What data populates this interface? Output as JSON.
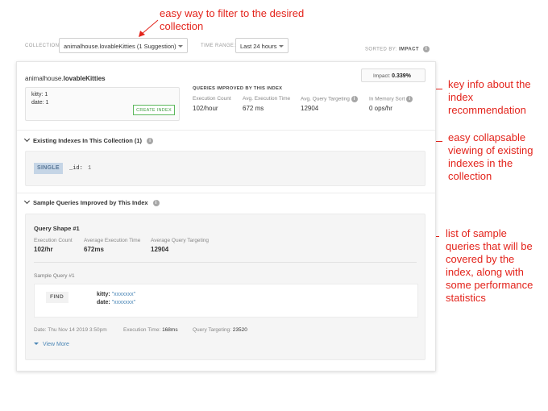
{
  "annotations": {
    "filter": [
      "easy way to filter to the desired",
      "collection"
    ],
    "key_info": [
      "key info about the",
      "index",
      "recommendation"
    ],
    "collapsable": [
      "easy collapsable",
      "viewing of existing",
      "indexes in the",
      "collection"
    ],
    "sample_queries": [
      "list of sample",
      "queries that will be",
      "covered by the",
      "index, along with",
      "some performance",
      "statistics"
    ]
  },
  "filter_bar": {
    "collection_label": "COLLECTION:",
    "collection_value": "animalhouse.lovableKitties (1 Suggestion)",
    "time_range_label": "TIME RANGE:",
    "time_range_value": "Last 24 hours",
    "sorted_by_label": "SORTED BY:",
    "sorted_by_value": "IMPACT"
  },
  "recommendation": {
    "namespace_db": "animalhouse.",
    "namespace_coll": "lovableKitties",
    "impact_label": "Impact:",
    "impact_value": "0.339%",
    "index_keys": [
      "kitty: 1",
      "date: 1"
    ],
    "create_index_label": "CREATE INDEX",
    "queries_improved_title": "QUERIES IMPROVED BY THIS INDEX",
    "stats": [
      {
        "label": "Execution Count",
        "value": "102/hour"
      },
      {
        "label": "Avg. Execution Time",
        "value": "672 ms"
      },
      {
        "label": "Avg. Query Targeting",
        "value": "12904"
      },
      {
        "label": "In Memory Sort",
        "value": "0 ops/hr"
      }
    ]
  },
  "existing_indexes": {
    "title": "Existing Indexes In This Collection (1)",
    "badge": "SINGLE",
    "field": "_id:",
    "direction": "1"
  },
  "sample_queries": {
    "title": "Sample Queries Improved by This Index",
    "shape_title": "Query Shape #1",
    "shape_stats": [
      {
        "label": "Execution Count",
        "value": "102/hr"
      },
      {
        "label": "Average Execution Time",
        "value": "672ms"
      },
      {
        "label": "Average Query Targeting",
        "value": "12904"
      }
    ],
    "sample_title": "Sample Query #1",
    "operation": "FIND",
    "query": [
      {
        "key": "kitty:",
        "value": "\"xxxxxxx\""
      },
      {
        "key": "date:",
        "value": "\"xxxxxxx\""
      }
    ],
    "footer": {
      "date_label": "Date:",
      "date_value": "Thu Nov 14 2019 3:50pm",
      "exec_label": "Execution Time:",
      "exec_value": "168ms",
      "targeting_label": "Query Targeting:",
      "targeting_value": "23520"
    },
    "view_more": "View More"
  },
  "colors": {
    "annotation": "#e3231b",
    "create_button": "#5cb85c",
    "link": "#4a86b6",
    "single_badge_bg": "#c5d5e6"
  }
}
